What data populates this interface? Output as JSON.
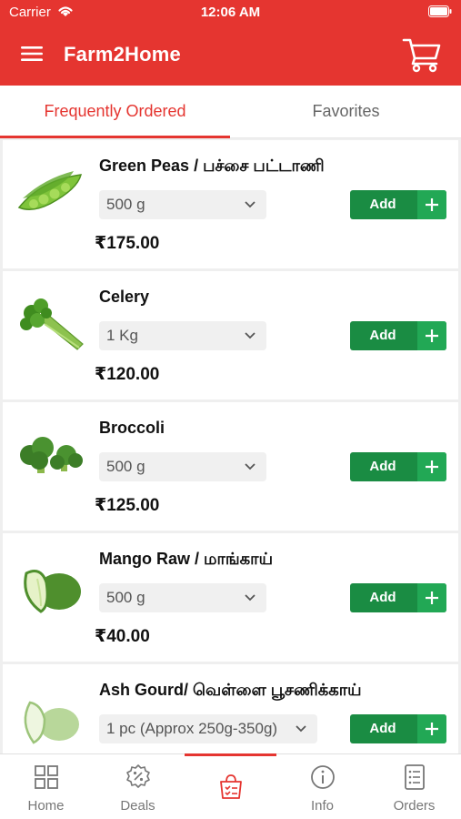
{
  "status_bar": {
    "carrier": "Carrier",
    "time": "12:06 AM"
  },
  "header": {
    "title": "Farm2Home",
    "menu_icon": "menu-icon",
    "cart_icon": "cart-icon"
  },
  "tabs": [
    {
      "label": "Frequently Ordered",
      "active": true
    },
    {
      "label": "Favorites",
      "active": false
    }
  ],
  "products": [
    {
      "name": "Green Peas / பச்சை பட்டாணி",
      "quantity": "500 g",
      "price": "₹175.00",
      "add_label": "Add",
      "image_icon": "green-peas"
    },
    {
      "name": "Celery",
      "quantity": "1 Kg",
      "price": "₹120.00",
      "add_label": "Add",
      "image_icon": "celery"
    },
    {
      "name": "Broccoli",
      "quantity": "500 g",
      "price": "₹125.00",
      "add_label": "Add",
      "image_icon": "broccoli"
    },
    {
      "name": "Mango Raw / மாங்காய்",
      "quantity": "500 g",
      "price": "₹40.00",
      "add_label": "Add",
      "image_icon": "raw-mango"
    },
    {
      "name": "Ash Gourd/ வெள்ளை பூசணிக்காய்",
      "quantity": "1 pc (Approx 250g-350g)",
      "price": "",
      "add_label": "Add",
      "image_icon": "ash-gourd"
    }
  ],
  "bottom_nav": [
    {
      "label": "Home",
      "icon": "grid-icon"
    },
    {
      "label": "Deals",
      "icon": "discount-badge-icon"
    },
    {
      "label": "",
      "icon": "shopping-bag-icon",
      "active": true
    },
    {
      "label": "Info",
      "icon": "info-icon"
    },
    {
      "label": "Orders",
      "icon": "orders-list-icon"
    }
  ],
  "colors": {
    "brand": "#e53530",
    "add_button": "#1a8c43",
    "add_plus": "#22a855"
  }
}
